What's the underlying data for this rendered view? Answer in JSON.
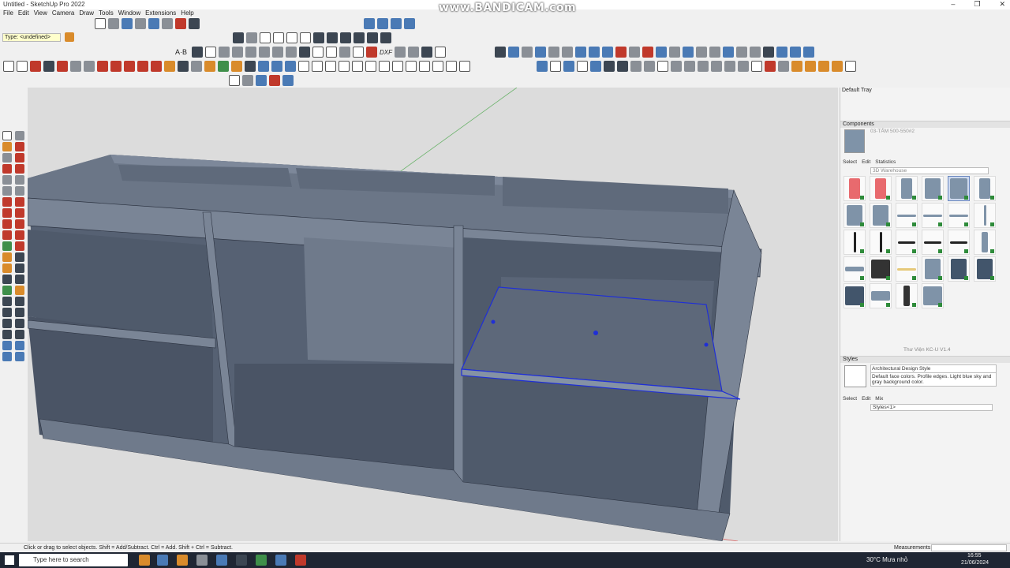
{
  "app": {
    "window_title": "Untitled - SketchUp Pro 2022",
    "watermark": "www.BANDICAM.com",
    "controls": [
      "–",
      "❐",
      "✕"
    ]
  },
  "menu": [
    "File",
    "Edit",
    "View",
    "Camera",
    "Draw",
    "Tools",
    "Window",
    "Extensions",
    "Help"
  ],
  "toolbar": {
    "type_field": "Type: <undefined>",
    "abc_label": "A·B",
    "dxf_label": "DXF"
  },
  "tray": {
    "title": "Default Tray",
    "components": {
      "header": "Components",
      "current_name": "03-TẤM 500-550#2",
      "tabs": [
        "Select",
        "Edit",
        "Statistics"
      ],
      "search_placeholder": "3D Warehouse",
      "library_name": "Thư Viện KC-U V1.4"
    },
    "styles": {
      "header": "Styles",
      "style_name": "Architectural Design Style",
      "style_desc": "Default face colors. Profile edges. Light blue sky and gray background color.",
      "tabs": [
        "Select",
        "Edit",
        "Mix"
      ],
      "dropdown": "Styles<1>"
    }
  },
  "status": {
    "hint": "Click or drag to select objects. Shift = Add/Subtract. Ctrl = Add. Shift + Ctrl = Subtract.",
    "measurements_label": "Measurements"
  },
  "taskbar": {
    "search_placeholder": "Type here to search",
    "weather": "30°C  Mưa nhỏ",
    "time": "16:55",
    "date": "21/06/2024"
  },
  "colors": {
    "cabinet_face": "#5b6677",
    "cabinet_dark": "#3e4656",
    "selection": "#1f2fd6",
    "viewport_bg": "#dcdcdc"
  }
}
